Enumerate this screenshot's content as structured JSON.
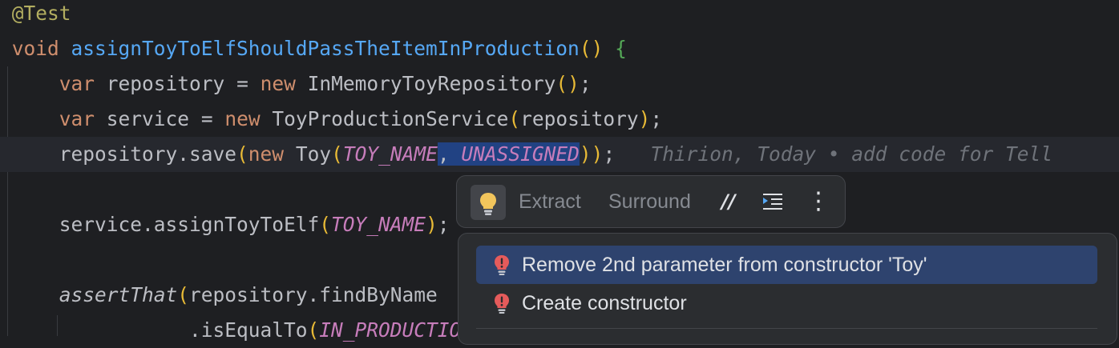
{
  "editor": {
    "line1": {
      "annotation": "@Test"
    },
    "line2": {
      "kw_void": "void",
      "method": "assignToyToElfShouldPassTheItemInProduction",
      "parens": "()",
      "brace": "{"
    },
    "line3": {
      "kw_var": "var",
      "name": "repository",
      "eq": " = ",
      "kw_new": "new",
      "type": "InMemoryToyRepository",
      "parens": "()",
      "semi": ";"
    },
    "line4": {
      "kw_var": "var",
      "name": "service",
      "eq": " = ",
      "kw_new": "new",
      "type": "ToyProductionService",
      "open": "(",
      "arg": "repository",
      "close": ")",
      "semi": ";"
    },
    "line5": {
      "call": "repository.save",
      "open": "(",
      "kw_new": "new",
      "type": "Toy",
      "open2": "(",
      "const1": "TOY_NAME",
      "comma": ", ",
      "const2": "UNASSIGNED",
      "close2": ")",
      "close": ")",
      "semi": ";",
      "blame": "Thirion, Today • add code for Tell"
    },
    "line7": {
      "call": "service.assignToyToElf",
      "open": "(",
      "const1": "TOY_NAME",
      "close": ")",
      "semi": ";"
    },
    "line9": {
      "method": "assertThat",
      "open": "(",
      "call": "repository.findByName"
    },
    "line10": {
      "call": ".isEqualTo",
      "open": "(",
      "const1": "IN_PRODUCTION"
    }
  },
  "toolbar": {
    "extract_label": "Extract",
    "surround_label": "Surround",
    "comment_icon_text": "//",
    "more_icon_text": "⋮"
  },
  "popup": {
    "items": [
      {
        "label": "Remove 2nd parameter from constructor 'Toy'",
        "selected": true
      },
      {
        "label": "Create constructor",
        "selected": false
      }
    ]
  },
  "colors": {
    "background": "#1e1f22",
    "keyword": "#cf8e6d",
    "method": "#56a8f5",
    "constant": "#c77dbb",
    "selection": "#214283",
    "popup_selected": "#2e436e",
    "error_icon": "#e55b5b",
    "bulb": "#f2c55c"
  }
}
